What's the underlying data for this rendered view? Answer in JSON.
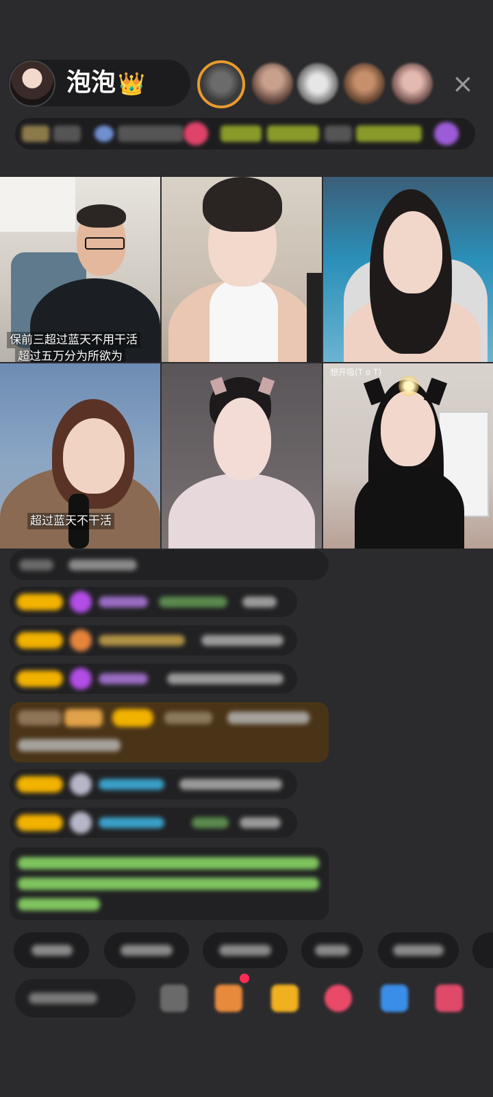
{
  "header": {
    "host_name": "泡泡",
    "crown_glyph": "👑",
    "close_glyph": "×"
  },
  "video_grid": {
    "tiles": [
      {
        "caption_lines": [
          "保前三超过蓝天不用干活",
          "超过五万分为所欲为"
        ]
      },
      {
        "caption_lines": []
      },
      {
        "caption_lines": []
      },
      {
        "caption_lines": [
          "超过蓝天不干活"
        ]
      },
      {
        "caption_lines": []
      },
      {
        "tag": "想开吸(T o T)"
      }
    ]
  },
  "colors": {
    "background": "#2b2b2d",
    "badge_gold": "#f2b200",
    "gem_purple": "#b24de6",
    "chat_green": "#7fc45e",
    "chat_blue": "#3aa0c8",
    "highlight_row": "#4a3418"
  }
}
